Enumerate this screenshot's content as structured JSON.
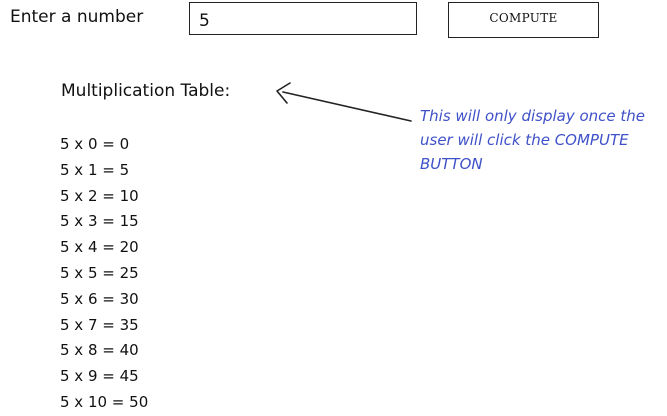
{
  "input": {
    "label": "Enter a number",
    "value": "5"
  },
  "compute_button": {
    "label": "COMPUTE"
  },
  "table": {
    "heading": "Multiplication Table:",
    "rows": [
      "5 x 0 = 0",
      "5 x 1 = 5",
      "5 x 2 = 10",
      "5 x 3 = 15",
      "5 x 4 = 20",
      "5 x 5 = 25",
      "5 x 6 = 30",
      "5 x 7 = 35",
      "5 x 8 = 40",
      "5 x 9 = 45",
      "5 x 10 = 50"
    ]
  },
  "annotation": {
    "text": "This will only display once the user will click the COMPUTE BUTTON",
    "color": "#3f51c8"
  },
  "icons": {
    "annotation_arrow": "arrow-left-icon"
  }
}
